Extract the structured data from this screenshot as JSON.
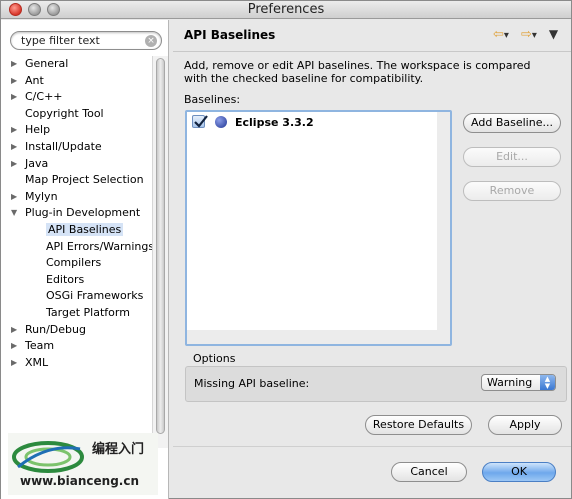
{
  "window": {
    "title": "Preferences"
  },
  "filter": {
    "value": "type filter text"
  },
  "tree": [
    {
      "label": "General",
      "expandable": true,
      "expanded": false
    },
    {
      "label": "Ant",
      "expandable": true,
      "expanded": false
    },
    {
      "label": "C/C++",
      "expandable": true,
      "expanded": false
    },
    {
      "label": "Copyright Tool",
      "expandable": false
    },
    {
      "label": "Help",
      "expandable": true,
      "expanded": false
    },
    {
      "label": "Install/Update",
      "expandable": true,
      "expanded": false
    },
    {
      "label": "Java",
      "expandable": true,
      "expanded": false
    },
    {
      "label": "Map Project Selection",
      "expandable": false
    },
    {
      "label": "Mylyn",
      "expandable": true,
      "expanded": false
    },
    {
      "label": "Plug-in Development",
      "expandable": true,
      "expanded": true
    },
    {
      "label": "API Baselines",
      "child": true,
      "selected": true
    },
    {
      "label": "API Errors/Warnings",
      "child": true
    },
    {
      "label": "Compilers",
      "child": true
    },
    {
      "label": "Editors",
      "child": true
    },
    {
      "label": "OSGi Frameworks",
      "child": true
    },
    {
      "label": "Target Platform",
      "child": true
    },
    {
      "label": "Run/Debug",
      "expandable": true,
      "expanded": false
    },
    {
      "label": "Team",
      "expandable": true,
      "expanded": false
    },
    {
      "label": "XML",
      "expandable": true,
      "expanded": false
    }
  ],
  "page": {
    "title": "API Baselines",
    "description": "Add, remove or edit API baselines. The workspace is compared with the checked baseline for compatibility.",
    "baselines_label": "Baselines:",
    "baselines": [
      {
        "name": "Eclipse 3.3.2",
        "checked": true
      }
    ],
    "buttons": {
      "add": "Add Baseline...",
      "edit": "Edit...",
      "remove": "Remove"
    },
    "options": {
      "label": "Options",
      "missing_label": "Missing API baseline:",
      "missing_value": "Warning"
    },
    "restore_defaults": "Restore Defaults",
    "apply": "Apply"
  },
  "dialog": {
    "cancel": "Cancel",
    "ok": "OK"
  },
  "watermark": {
    "cn_text": "编程入门",
    "url": "www.bianceng.cn"
  }
}
